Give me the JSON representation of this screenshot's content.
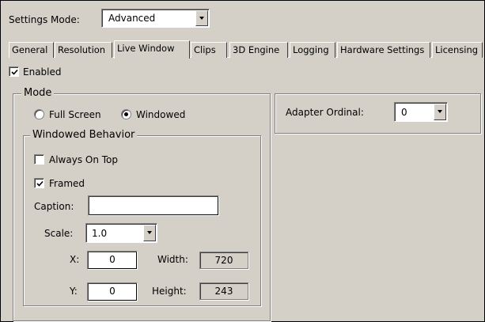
{
  "settings_mode": {
    "label": "Settings Mode:",
    "value": "Advanced"
  },
  "tabs": [
    {
      "label": "General",
      "active": false
    },
    {
      "label": "Resolution",
      "active": false
    },
    {
      "label": "Live Window",
      "active": true
    },
    {
      "label": "Clips",
      "active": false
    },
    {
      "label": "3D Engine",
      "active": false
    },
    {
      "label": "Logging",
      "active": false
    },
    {
      "label": "Hardware Settings",
      "active": false
    },
    {
      "label": "Licensing",
      "active": false
    }
  ],
  "enabled": {
    "label": "Enabled",
    "checked": true
  },
  "mode": {
    "title": "Mode",
    "full_screen": {
      "label": "Full Screen",
      "selected": false
    },
    "windowed": {
      "label": "Windowed",
      "selected": true
    }
  },
  "windowed_behavior": {
    "title": "Windowed Behavior",
    "always_on_top": {
      "label": "Always On Top",
      "checked": false
    },
    "framed": {
      "label": "Framed",
      "checked": true
    },
    "caption": {
      "label": "Caption:",
      "value": ""
    },
    "scale": {
      "label": "Scale:",
      "value": "1.0"
    },
    "x": {
      "label": "X:",
      "value": "0"
    },
    "y": {
      "label": "Y:",
      "value": "0"
    },
    "width": {
      "label": "Width:",
      "value": "720"
    },
    "height": {
      "label": "Height:",
      "value": "243"
    }
  },
  "adapter": {
    "label": "Adapter Ordinal:",
    "value": "0"
  }
}
